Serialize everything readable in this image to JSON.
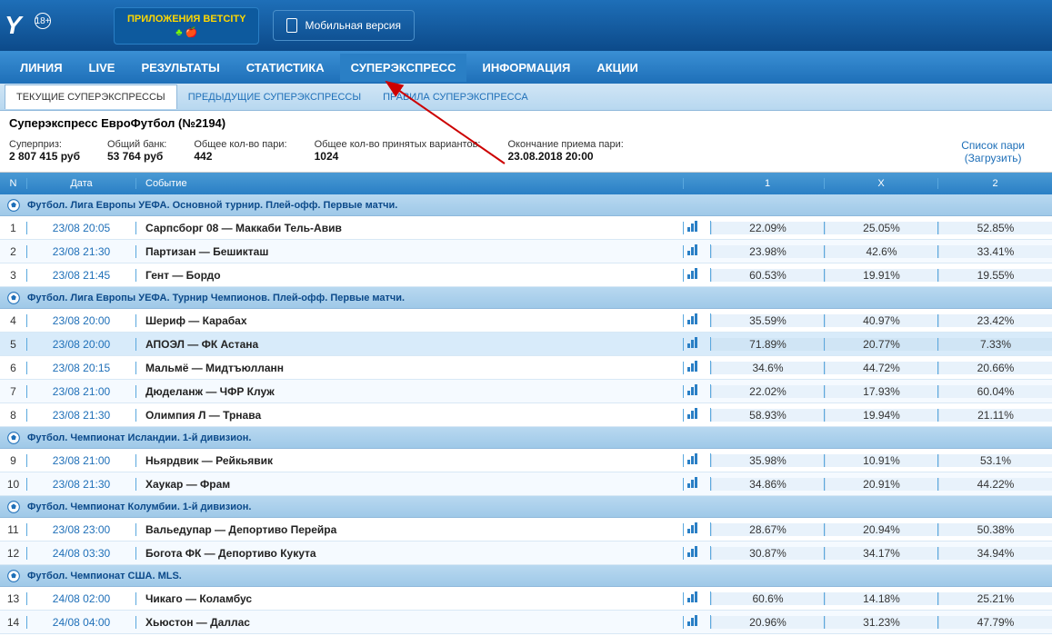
{
  "top": {
    "age": "18+",
    "app_btn": "ПРИЛОЖЕНИЯ BETCITY",
    "mobile_btn": "Мобильная версия"
  },
  "nav": [
    "ЛИНИЯ",
    "LIVE",
    "РЕЗУЛЬТАТЫ",
    "СТАТИСТИКА",
    "СУПЕРЭКСПРЕСС",
    "ИНФОРМАЦИЯ",
    "АКЦИИ"
  ],
  "sub_nav": [
    "ТЕКУЩИЕ СУПЕРЭКСПРЕССЫ",
    "ПРЕДЫДУЩИЕ СУПЕРЭКСПРЕССЫ",
    "ПРАВИЛА СУПЕРЭКСПРЕССА"
  ],
  "title": "Суперэкспресс ЕвроФутбол (№2194)",
  "info": {
    "superprize_label": "Суперприз:",
    "superprize_value": "2 807 415 руб",
    "bank_label": "Общий банк:",
    "bank_value": "53 764 руб",
    "total_bets_label": "Общее кол-во пари:",
    "total_bets_value": "442",
    "total_variants_label": "Общее кол-во принятых вариантов:",
    "total_variants_value": "1024",
    "end_label": "Окончание приема пари:",
    "end_value": "23.08.2018 20:00",
    "list_link": "Список пари",
    "download_link": "(Загрузить)"
  },
  "headers": {
    "n": "N",
    "date": "Дата",
    "event": "Событие",
    "c1": "1",
    "cx": "X",
    "c2": "2"
  },
  "data": [
    {
      "type": "group",
      "title": "Футбол. Лига Европы УЕФА. Основной турнир. Плей-офф. Первые матчи."
    },
    {
      "type": "event",
      "n": "1",
      "date": "23/08 20:05",
      "event": "Сарпсборг 08 — Маккаби Тель-Авив",
      "c1": "22.09%",
      "cx": "25.05%",
      "c2": "52.85%"
    },
    {
      "type": "event",
      "n": "2",
      "date": "23/08 21:30",
      "event": "Партизан — Бешикташ",
      "c1": "23.98%",
      "cx": "42.6%",
      "c2": "33.41%"
    },
    {
      "type": "event",
      "n": "3",
      "date": "23/08 21:45",
      "event": "Гент — Бордо",
      "c1": "60.53%",
      "cx": "19.91%",
      "c2": "19.55%"
    },
    {
      "type": "group",
      "title": "Футбол. Лига Европы УЕФА. Турнир Чемпионов. Плей-офф. Первые матчи."
    },
    {
      "type": "event",
      "n": "4",
      "date": "23/08 20:00",
      "event": "Шериф — Карабах",
      "c1": "35.59%",
      "cx": "40.97%",
      "c2": "23.42%"
    },
    {
      "type": "event",
      "n": "5",
      "date": "23/08 20:00",
      "event": "АПОЭЛ — ФК Астана",
      "c1": "71.89%",
      "cx": "20.77%",
      "c2": "7.33%",
      "sel": true
    },
    {
      "type": "event",
      "n": "6",
      "date": "23/08 20:15",
      "event": "Мальмё — Мидтъюлланн",
      "c1": "34.6%",
      "cx": "44.72%",
      "c2": "20.66%"
    },
    {
      "type": "event",
      "n": "7",
      "date": "23/08 21:00",
      "event": "Дюделанж — ЧФР Клуж",
      "c1": "22.02%",
      "cx": "17.93%",
      "c2": "60.04%"
    },
    {
      "type": "event",
      "n": "8",
      "date": "23/08 21:30",
      "event": "Олимпия Л — Трнава",
      "c1": "58.93%",
      "cx": "19.94%",
      "c2": "21.11%"
    },
    {
      "type": "group",
      "title": "Футбол. Чемпионат Исландии. 1-й дивизион."
    },
    {
      "type": "event",
      "n": "9",
      "date": "23/08 21:00",
      "event": "Ньярдвик — Рейкьявик",
      "c1": "35.98%",
      "cx": "10.91%",
      "c2": "53.1%"
    },
    {
      "type": "event",
      "n": "10",
      "date": "23/08 21:30",
      "event": "Хаукар — Фрам",
      "c1": "34.86%",
      "cx": "20.91%",
      "c2": "44.22%"
    },
    {
      "type": "group",
      "title": "Футбол. Чемпионат Колумбии. 1-й дивизион."
    },
    {
      "type": "event",
      "n": "11",
      "date": "23/08 23:00",
      "event": "Вальедупар — Депортиво Перейра",
      "c1": "28.67%",
      "cx": "20.94%",
      "c2": "50.38%"
    },
    {
      "type": "event",
      "n": "12",
      "date": "24/08 03:30",
      "event": "Богота ФК — Депортиво Кукута",
      "c1": "30.87%",
      "cx": "34.17%",
      "c2": "34.94%"
    },
    {
      "type": "group",
      "title": "Футбол. Чемпионат США. MLS."
    },
    {
      "type": "event",
      "n": "13",
      "date": "24/08 02:00",
      "event": "Чикаго — Коламбус",
      "c1": "60.6%",
      "cx": "14.18%",
      "c2": "25.21%"
    },
    {
      "type": "event",
      "n": "14",
      "date": "24/08 04:00",
      "event": "Хьюстон — Даллас",
      "c1": "20.96%",
      "cx": "31.23%",
      "c2": "47.79%"
    }
  ]
}
